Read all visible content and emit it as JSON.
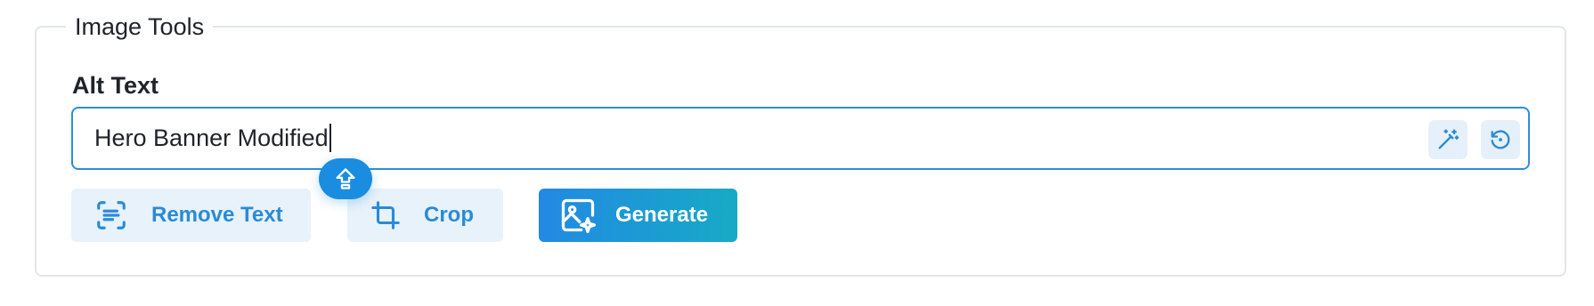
{
  "section": {
    "legend": "Image Tools"
  },
  "alt_text": {
    "label": "Alt Text",
    "value": "Hero Banner Modified",
    "actions": [
      {
        "name": "magic-wand-icon"
      },
      {
        "name": "reset-icon"
      }
    ]
  },
  "buttons": {
    "remove_text": "Remove Text",
    "crop": "Crop",
    "generate": "Generate"
  },
  "icons": {
    "remove_text": "scan-text-icon",
    "crop": "crop-icon",
    "generate": "image-sparkle-icon",
    "floating": "shift-arrow-icon"
  },
  "colors": {
    "accent": "#2a8bd7",
    "input_border": "#2d8fd5",
    "light_button_bg": "#e8f2fb",
    "generate_gradient_start": "#2289e3",
    "generate_gradient_end": "#17aac6",
    "panel_border": "#e3e5e8"
  }
}
